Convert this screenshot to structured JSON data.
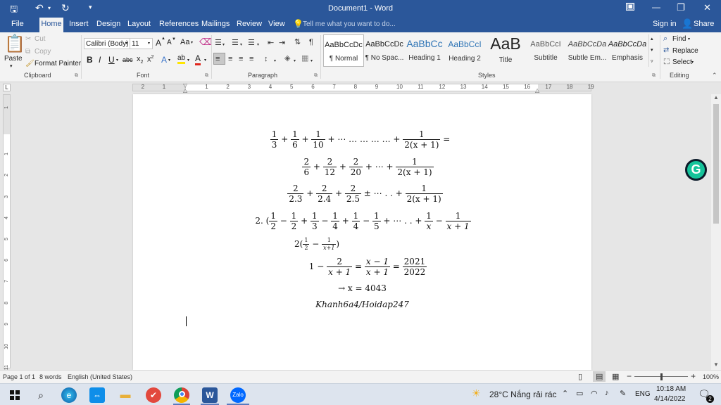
{
  "window": {
    "title": "Document1 - Word",
    "quick_access": {
      "save": "save-icon",
      "undo": "undo-icon",
      "redo": "redo-icon",
      "customize": "▾"
    },
    "controls": {
      "ribbon_display": "ribbon-display-icon",
      "minimize": "—",
      "restore": "❐",
      "close": "✕"
    }
  },
  "tabs": [
    {
      "label": "File"
    },
    {
      "label": "Home"
    },
    {
      "label": "Insert"
    },
    {
      "label": "Design"
    },
    {
      "label": "Layout"
    },
    {
      "label": "References"
    },
    {
      "label": "Mailings"
    },
    {
      "label": "Review"
    },
    {
      "label": "View"
    }
  ],
  "tell_me": {
    "placeholder": "Tell me what you want to do..."
  },
  "account": {
    "sign_in": "Sign in",
    "share": "Share"
  },
  "clipboard": {
    "paste": "Paste",
    "cut": "Cut",
    "copy": "Copy",
    "format_painter": "Format Painter",
    "group_label": "Clipboard"
  },
  "font": {
    "family": "Calibri (Body)",
    "size": "11",
    "group_label": "Font",
    "grow": "A",
    "shrink": "A",
    "case": "Aa",
    "bold": "B",
    "italic": "I",
    "underline": "U",
    "strike": "abc",
    "subscript": "x",
    "superscript": "x",
    "subscript_mark": "2",
    "superscript_mark": "2",
    "text_effects": "A",
    "highlight": "ab",
    "font_color": "A"
  },
  "paragraph": {
    "group_label": "Paragraph"
  },
  "styles": {
    "group_label": "Styles",
    "items": [
      {
        "preview": "AaBbCcDc",
        "name": "¶ Normal"
      },
      {
        "preview": "AaBbCcDc",
        "name": "¶ No Spac..."
      },
      {
        "preview": "AaBbCc",
        "name": "Heading 1"
      },
      {
        "preview": "AaBbCcI",
        "name": "Heading 2"
      },
      {
        "preview": "AaB",
        "name": "Title"
      },
      {
        "preview": "AaBbCcI",
        "name": "Subtitle"
      },
      {
        "preview": "AaBbCcDa",
        "name": "Subtle Em..."
      },
      {
        "preview": "AaBbCcDa",
        "name": "Emphasis"
      }
    ]
  },
  "editing": {
    "find": "Find",
    "replace": "Replace",
    "select": "Select",
    "group_label": "Editing"
  },
  "ruler": {
    "corner": "L",
    "labels": [
      "2",
      "1",
      "1",
      "2",
      "3",
      "4",
      "5",
      "6",
      "7",
      "8",
      "9",
      "10",
      "11",
      "12",
      "13",
      "14",
      "15",
      "16",
      "17",
      "18",
      "19"
    ],
    "vlabels": [
      "1",
      "1",
      "2",
      "3",
      "4",
      "5",
      "6",
      "7",
      "8",
      "9",
      "10",
      "11"
    ]
  },
  "document": {
    "lines": {
      "l1_n": "1",
      "l1_d1": "3",
      "l1_d2": "6",
      "l1_d3": "10",
      "l1_mid": " + ⋯ … … … … + ",
      "l1_last_n": "1",
      "l1_last_d": "2(x + 1)",
      "l1_end": " =",
      "l2_n": "2",
      "l2_d1": "6",
      "l2_d2": "12",
      "l2_d3": "20",
      "l2_mid": " + ⋯ + ",
      "l2_last_n": "1",
      "l2_last_d": "2(x + 1)",
      "l3_n": "2",
      "l3_d1": "2.3",
      "l3_d2": "2.4",
      "l3_d3": "2.5",
      "l3_mid": " ± ⋯ . . + ",
      "l3_last_n": "1",
      "l3_last_d": "2(x + 1)",
      "l4_prefix": "2. (",
      "l4_n": "1",
      "l4_d": [
        "2",
        "2",
        "3",
        "4",
        "4",
        "5"
      ],
      "l4_mid": " + ⋯ . . + ",
      "l4_x": "x",
      "l4_xd": "x + 1",
      "l5_prefix": "2(",
      "l5_n": "1",
      "l5_d1": "2",
      "l5_d2": "x+1",
      "l5_end": ")",
      "l6_one": "1 − ",
      "l6_n1": "2",
      "l6_d1": "x + 1",
      "l6_n2": "x − 1",
      "l6_d2": "x + 1",
      "l6_n3": "2021",
      "l6_d3": "2022",
      "l7": "→ x = 4043",
      "l8": "Khanh6a4/Hoidap247"
    }
  },
  "grammarly": {
    "letter": "G"
  },
  "status": {
    "page": "Page 1 of 1",
    "words": "8 words",
    "language": "English (United States)",
    "zoom": "100%",
    "zoom_level": 0.5
  },
  "taskbar": {
    "apps": [
      "windows-icon",
      "search-icon",
      "edge-icon",
      "teamviewer-icon",
      "explorer-icon",
      "todo-icon",
      "chrome-icon",
      "word-icon",
      "zalo-icon"
    ],
    "word_label": "W",
    "zalo_label": "Zalo",
    "weather": "28°C  Nắng rải rác",
    "lang": "ENG",
    "time": "10:18 AM",
    "date": "4/14/2022",
    "notifications": "2"
  }
}
